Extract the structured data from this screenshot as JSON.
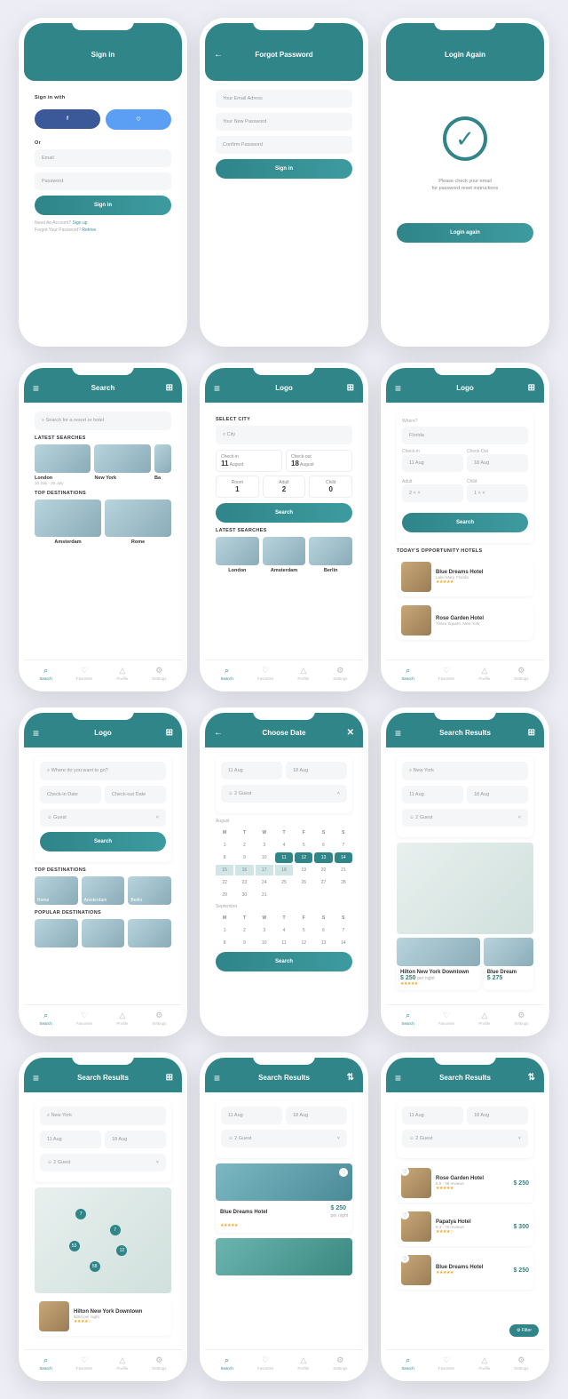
{
  "s1": {
    "title": "Sign in",
    "signInWith": "Sign in with",
    "or": "Or",
    "email": "Email",
    "password": "Password",
    "btn": "Sign in",
    "needAcc": "Need An Account?",
    "signup": "Sign up",
    "forgot": "Forgot Your Password?",
    "retrive": "Retrive"
  },
  "s2": {
    "title": "Forgot Password",
    "email": "Your Email Adress",
    "newpw": "Your New Password",
    "confirm": "Confirm Password",
    "btn": "Sign in"
  },
  "s3": {
    "title": "Login Again",
    "msg1": "Please check your email",
    "msg2": "for password reset instructions",
    "btn": "Login again"
  },
  "s4": {
    "title": "Search",
    "search": "Search for a resort or hotel",
    "latest": "LATEST SEARCHES",
    "c1": "London",
    "c1d": "10 July - 20 July",
    "c2": "New York",
    "c2d": "",
    "c3": "Ba",
    "top": "TOP DESTINATIONS",
    "d1": "Amsterdam",
    "d2": "Rome"
  },
  "s5": {
    "title": "Logo",
    "select": "SELECT CITY",
    "city": "City",
    "checkin": "Check-in",
    "d1": "11",
    "m1": "August",
    "checkout": "Check-out",
    "d2": "18",
    "m2": "August",
    "room": "Room",
    "rv": "1",
    "adult": "Adult",
    "av": "2",
    "child": "Child",
    "cv": "0",
    "btn": "Search",
    "latest": "LATEST SEARCHES",
    "l1": "London",
    "l2": "Amsterdam",
    "l3": "Berlin"
  },
  "s6": {
    "title": "Logo",
    "where": "Where?",
    "city": "Florida",
    "ci": "Check-in",
    "civ": "11 Aug",
    "co": "Check-Out",
    "cov": "18 Aug",
    "adult": "Adult",
    "av": "2",
    "child": "Child",
    "cv": "1",
    "btn": "Search",
    "opp": "TODAY'S OPPORTUNITY HOTELS",
    "h1": "Blue Dreams Hotel",
    "h1l": "Lake Mary, Florida",
    "h2": "Rose Garden Hotel",
    "h2l": "Times Square, New York"
  },
  "s7": {
    "title": "Logo",
    "where": "Where do you want to go?",
    "ci": "Check-in Date",
    "co": "Check-out Date",
    "guest": "Guest",
    "btn": "Search",
    "top": "TOP DESTINATIONS",
    "d1": "Rome",
    "d2": "Amsterdam",
    "d3": "Berlin",
    "pop": "POPULAR DESTINATIONS"
  },
  "s8": {
    "title": "Choose Date",
    "d1": "11 Aug",
    "d2": "18 Aug",
    "guest": "2 Guest",
    "month": "August",
    "days": [
      "M",
      "T",
      "W",
      "T",
      "F",
      "S",
      "S"
    ],
    "sept": "September",
    "btn": "Search"
  },
  "s9": {
    "title": "Search Results",
    "city": "New York",
    "d1": "11 Aug",
    "d2": "18 Aug",
    "guest": "2 Guest",
    "h1": "Hilton New York Downtown",
    "p1": "$ 250",
    "pn": "per night",
    "h2": "Blue Dream",
    "p2": "$ 275"
  },
  "s10": {
    "title": "Search Results",
    "city": "New York",
    "d1": "11 Aug",
    "d2": "18 Aug",
    "guest": "2 Guest",
    "h1": "Hilton New York Downtown",
    "h1s": "$254 per night"
  },
  "s11": {
    "title": "Search Results",
    "d1": "11 Aug",
    "d2": "18 Aug",
    "guest": "2 Guest",
    "h1": "Blue Dreams Hotel",
    "p1": "$ 250",
    "pn": "per night"
  },
  "s12": {
    "title": "Search Results",
    "d1": "11 Aug",
    "d2": "18 Aug",
    "guest": "2 Guest",
    "h1": "Rose Garden Hotel",
    "r1": "8.5 - 36 reviews",
    "p1": "$ 250",
    "h2": "Papatya Hotel",
    "r2": "8.3 - 70 reviews",
    "p2": "$ 300",
    "h3": "Blue Dreams Hotel",
    "p3": "$ 250",
    "filter": "Filter"
  },
  "nav": {
    "search": "Search",
    "fav": "Favorites",
    "profile": "Profile",
    "settings": "Settings"
  }
}
